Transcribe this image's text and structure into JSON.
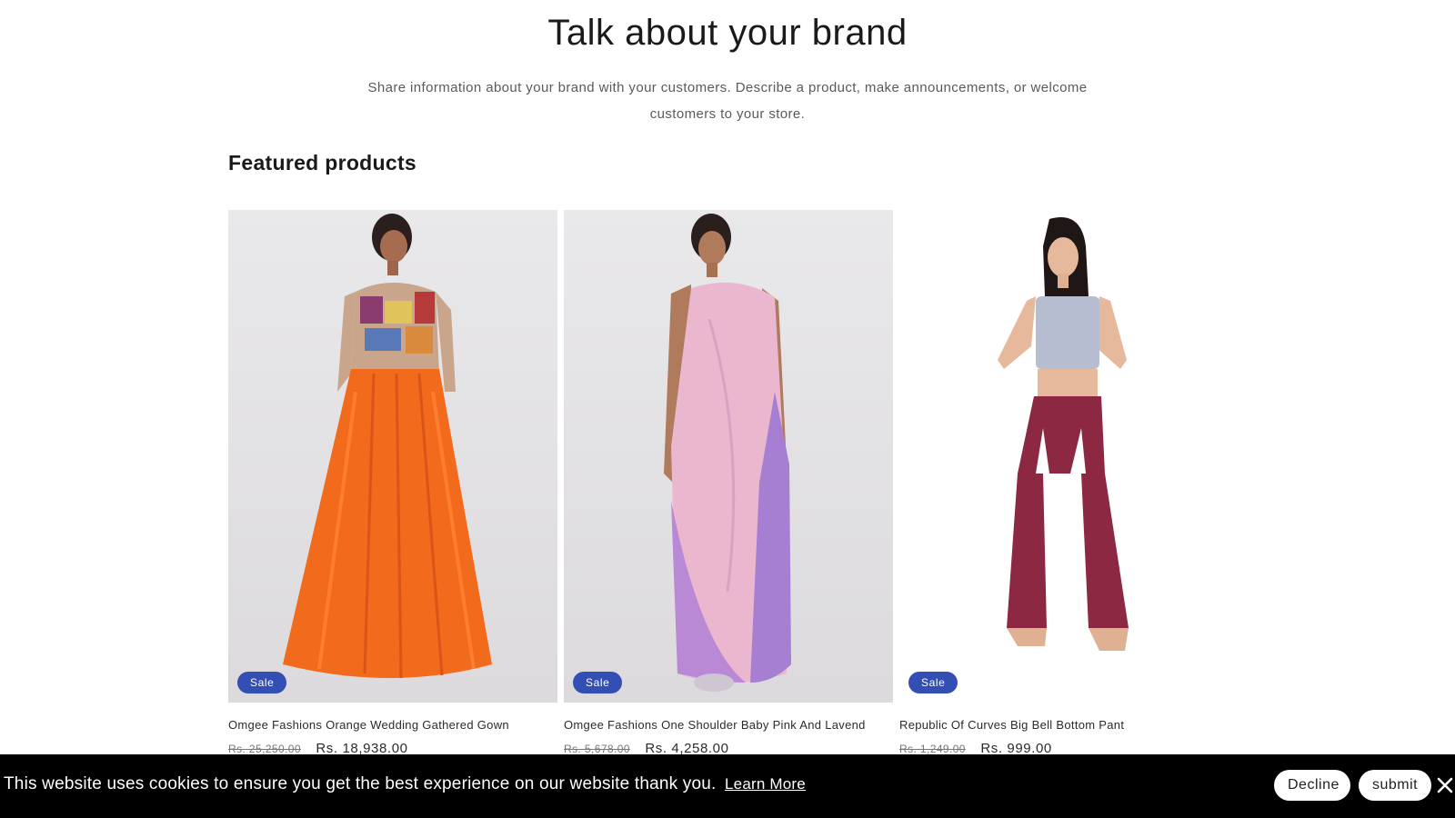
{
  "brand": {
    "title": "Talk about your brand",
    "text": "Share information about your brand with your customers. Describe a product, make announcements, or welcome customers to your store."
  },
  "featured": {
    "heading": "Featured products",
    "products": [
      {
        "title": "Omgee Fashions Orange Wedding Gathered Gown",
        "badge": "Sale",
        "price_old": "Rs. 25,250.00",
        "price_new": "Rs. 18,938.00",
        "image": "woman-in-orange-gathered-gown"
      },
      {
        "title": "Omgee Fashions One Shoulder Baby Pink And Lavend",
        "badge": "Sale",
        "price_old": "Rs. 5,678.00",
        "price_new": "Rs. 4,258.00",
        "image": "woman-in-one-shoulder-pink-lavender-drape"
      },
      {
        "title": "Republic Of Curves Big Bell Bottom Pant",
        "badge": "Sale",
        "price_old": "Rs. 1,249.00",
        "price_new": "Rs. 999.00",
        "image": "woman-in-maroon-bell-bottom-pants"
      }
    ]
  },
  "cookie": {
    "text": "This website uses cookies to ensure you get the best experience on our website thank you.",
    "link": "Learn More",
    "decline": "Decline",
    "submit": "submit",
    "close_icon": "close-icon"
  },
  "colors": {
    "sale_badge": "#334fb4",
    "cookie_bar": "#000000"
  }
}
